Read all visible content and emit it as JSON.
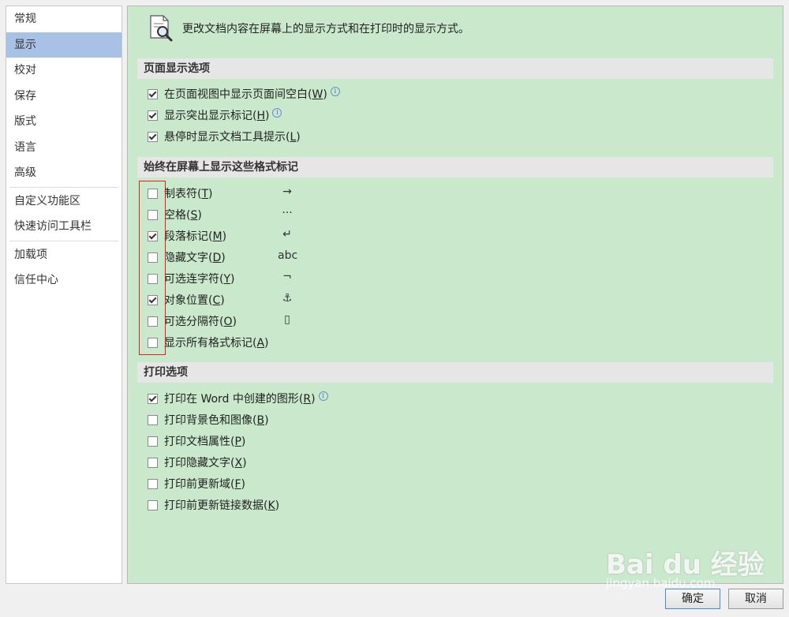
{
  "sidebar": {
    "items": [
      {
        "label": "常规"
      },
      {
        "label": "显示"
      },
      {
        "label": "校对"
      },
      {
        "label": "保存"
      },
      {
        "label": "版式"
      },
      {
        "label": "语言"
      },
      {
        "label": "高级"
      },
      {
        "label": "自定义功能区"
      },
      {
        "label": "快速访问工具栏"
      },
      {
        "label": "加载项"
      },
      {
        "label": "信任中心"
      }
    ],
    "selected": "显示"
  },
  "main": {
    "header": "更改文档内容在屏幕上的显示方式和在打印时的显示方式。",
    "page_display": {
      "title": "页面显示选项",
      "options": [
        {
          "text": "在页面视图中显示页面间空白",
          "key": "W",
          "checked": true,
          "info": true
        },
        {
          "text": "显示突出显示标记",
          "key": "H",
          "checked": true,
          "info": true
        },
        {
          "text": "悬停时显示文档工具提示",
          "key": "L",
          "checked": true,
          "info": false
        }
      ]
    },
    "format_marks": {
      "title": "始终在屏幕上显示这些格式标记",
      "options": [
        {
          "text": "制表符",
          "key": "T",
          "checked": false,
          "symbol": "→"
        },
        {
          "text": "空格",
          "key": "S",
          "checked": false,
          "symbol": "···"
        },
        {
          "text": "段落标记",
          "key": "M",
          "checked": true,
          "symbol": "↵"
        },
        {
          "text": "隐藏文字",
          "key": "D",
          "checked": false,
          "symbol": "abc"
        },
        {
          "text": "可选连字符",
          "key": "Y",
          "checked": false,
          "symbol": "¬"
        },
        {
          "text": "对象位置",
          "key": "C",
          "checked": true,
          "symbol": "⚓"
        },
        {
          "text": "可选分隔符",
          "key": "O",
          "checked": false,
          "symbol": "▯"
        },
        {
          "text": "显示所有格式标记",
          "key": "A",
          "checked": false,
          "symbol": ""
        }
      ]
    },
    "print": {
      "title": "打印选项",
      "options": [
        {
          "text": "打印在 Word 中创建的图形",
          "key": "R",
          "checked": true,
          "info": true
        },
        {
          "text": "打印背景色和图像",
          "key": "B",
          "checked": false,
          "info": false
        },
        {
          "text": "打印文档属性",
          "key": "P",
          "checked": false,
          "info": false
        },
        {
          "text": "打印隐藏文字",
          "key": "X",
          "checked": false,
          "info": false
        },
        {
          "text": "打印前更新域",
          "key": "F",
          "checked": false,
          "info": false
        },
        {
          "text": "打印前更新链接数据",
          "key": "K",
          "checked": false,
          "info": false
        }
      ]
    }
  },
  "buttons": {
    "ok": "确定",
    "cancel": "取消"
  },
  "watermark": {
    "brand": "Bai du 经验",
    "url": "jingyan.baidu.com"
  },
  "colors": {
    "panel_bg": "#c9e8cc",
    "selected_nav": "#a9c1e4",
    "highlight_box": "#e02020"
  }
}
